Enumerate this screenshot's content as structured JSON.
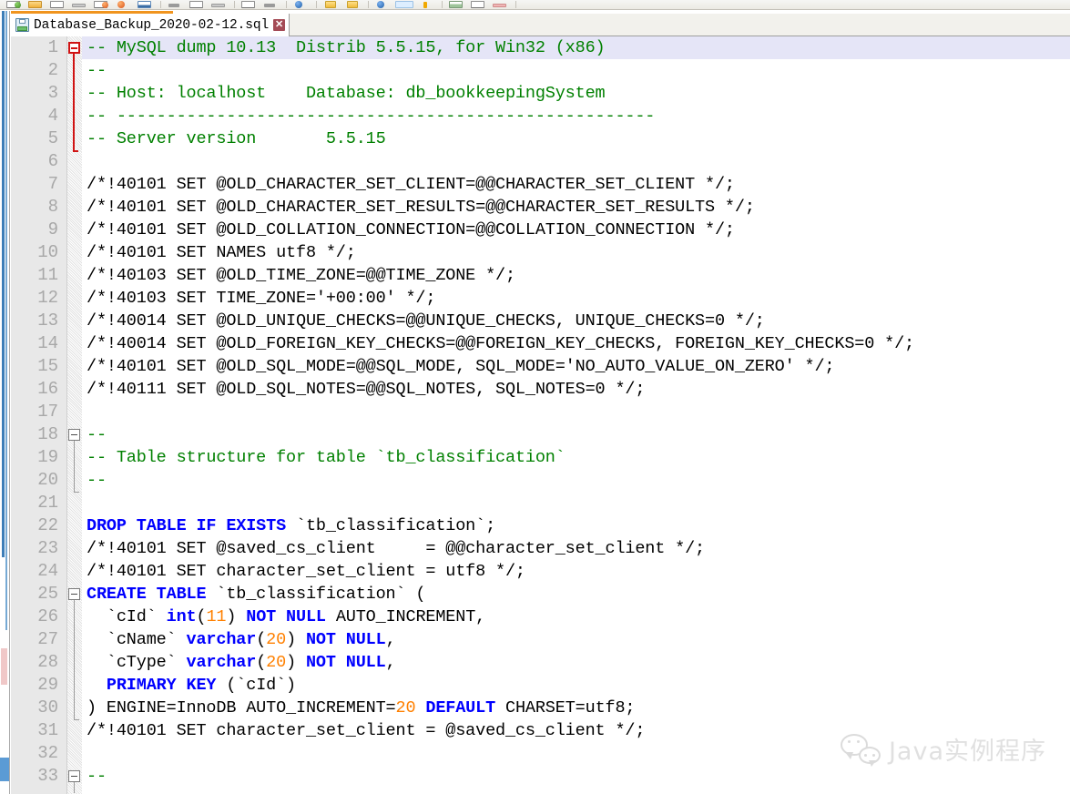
{
  "toolbar": {
    "items": [
      {
        "name": "new-file-icon",
        "style": "g-green"
      },
      {
        "name": "open-folder-icon",
        "style": "g-folder"
      },
      {
        "name": "save-icon",
        "style": "g-plain"
      },
      {
        "name": "save-all-icon",
        "style": "g-gray"
      },
      {
        "name": "close-file-icon",
        "style": "g-orange"
      },
      {
        "name": "close-all-icon",
        "style": "g-orangesolid"
      },
      {
        "name": "print-icon",
        "style": "g-bluebox"
      },
      {
        "sep": true
      },
      {
        "name": "cut-icon",
        "style": "g-darkgray"
      },
      {
        "name": "copy-icon",
        "style": "g-plain"
      },
      {
        "name": "paste-icon",
        "style": "g-gray"
      },
      {
        "sep": true
      },
      {
        "name": "undo-icon",
        "style": "g-plain"
      },
      {
        "name": "redo-icon",
        "style": "g-darkgray"
      },
      {
        "sep": true
      },
      {
        "name": "find-icon",
        "style": "g-blue"
      },
      {
        "sep": true
      },
      {
        "name": "zoom-in-icon",
        "style": "g-yellow"
      },
      {
        "name": "zoom-out-icon",
        "style": "g-yellow"
      },
      {
        "sep": true
      },
      {
        "name": "show-symbol-icon",
        "style": "g-blue"
      },
      {
        "name": "word-wrap-icon",
        "style": "g-lightblue"
      },
      {
        "name": "bookmark-icon",
        "style": "g-amber"
      },
      {
        "sep": true
      },
      {
        "name": "macro-record-icon",
        "style": "g-greenbar"
      },
      {
        "name": "macro-stop-icon",
        "style": "g-plain"
      },
      {
        "name": "macro-play-icon",
        "style": "g-pink"
      },
      {
        "sep": true
      }
    ]
  },
  "tab": {
    "title": "Database_Backup_2020-02-12.sql",
    "close_label": "✕",
    "icon_name": "floppy-disk-icon"
  },
  "editor": {
    "current_line": 1,
    "colors": {
      "comment": "#008000",
      "keyword": "#0000ff",
      "number": "#ff8000",
      "text": "#000000",
      "current_line_bg": "#e5e5f7",
      "gutter_bg": "#e8e8e8",
      "line_number": "#a8a8a8",
      "fold_active": "#d01414",
      "fold_inactive": "#7b7b7b"
    },
    "folds": [
      {
        "start": 1,
        "end": 5,
        "active": true
      },
      {
        "start": 18,
        "end": 20,
        "active": false
      },
      {
        "start": 25,
        "end": 30,
        "active": false
      },
      {
        "start": 33,
        "end": 33,
        "active": false
      }
    ],
    "lines": [
      {
        "n": 1,
        "tokens": [
          {
            "t": "-- MySQL dump 10.13  Distrib 5.5.15, for Win32 (x86)",
            "c": "c-comment"
          }
        ]
      },
      {
        "n": 2,
        "tokens": [
          {
            "t": "--",
            "c": "c-comment"
          }
        ]
      },
      {
        "n": 3,
        "tokens": [
          {
            "t": "-- Host: localhost    Database: db_bookkeepingSystem",
            "c": "c-comment"
          }
        ]
      },
      {
        "n": 4,
        "tokens": [
          {
            "t": "-- ------------------------------------------------------",
            "c": "c-comment"
          }
        ]
      },
      {
        "n": 5,
        "tokens": [
          {
            "t": "-- Server version\t5.5.15",
            "c": "c-comment"
          }
        ]
      },
      {
        "n": 6,
        "tokens": []
      },
      {
        "n": 7,
        "tokens": [
          {
            "t": "/*!40101 SET @OLD_CHARACTER_SET_CLIENT=@@CHARACTER_SET_CLIENT */;",
            "c": "c-plain"
          }
        ]
      },
      {
        "n": 8,
        "tokens": [
          {
            "t": "/*!40101 SET @OLD_CHARACTER_SET_RESULTS=@@CHARACTER_SET_RESULTS */;",
            "c": "c-plain"
          }
        ]
      },
      {
        "n": 9,
        "tokens": [
          {
            "t": "/*!40101 SET @OLD_COLLATION_CONNECTION=@@COLLATION_CONNECTION */;",
            "c": "c-plain"
          }
        ]
      },
      {
        "n": 10,
        "tokens": [
          {
            "t": "/*!40101 SET NAMES utf8 */;",
            "c": "c-plain"
          }
        ]
      },
      {
        "n": 11,
        "tokens": [
          {
            "t": "/*!40103 SET @OLD_TIME_ZONE=@@TIME_ZONE */;",
            "c": "c-plain"
          }
        ]
      },
      {
        "n": 12,
        "tokens": [
          {
            "t": "/*!40103 SET TIME_ZONE='+00:00' */;",
            "c": "c-plain"
          }
        ]
      },
      {
        "n": 13,
        "tokens": [
          {
            "t": "/*!40014 SET @OLD_UNIQUE_CHECKS=@@UNIQUE_CHECKS, UNIQUE_CHECKS=0 */;",
            "c": "c-plain"
          }
        ]
      },
      {
        "n": 14,
        "tokens": [
          {
            "t": "/*!40014 SET @OLD_FOREIGN_KEY_CHECKS=@@FOREIGN_KEY_CHECKS, FOREIGN_KEY_CHECKS=0 */;",
            "c": "c-plain"
          }
        ]
      },
      {
        "n": 15,
        "tokens": [
          {
            "t": "/*!40101 SET @OLD_SQL_MODE=@@SQL_MODE, SQL_MODE='NO_AUTO_VALUE_ON_ZERO' */;",
            "c": "c-plain"
          }
        ]
      },
      {
        "n": 16,
        "tokens": [
          {
            "t": "/*!40111 SET @OLD_SQL_NOTES=@@SQL_NOTES, SQL_NOTES=0 */;",
            "c": "c-plain"
          }
        ]
      },
      {
        "n": 17,
        "tokens": []
      },
      {
        "n": 18,
        "tokens": [
          {
            "t": "--",
            "c": "c-comment"
          }
        ]
      },
      {
        "n": 19,
        "tokens": [
          {
            "t": "-- Table structure for table `tb_classification`",
            "c": "c-comment"
          }
        ]
      },
      {
        "n": 20,
        "tokens": [
          {
            "t": "--",
            "c": "c-comment"
          }
        ]
      },
      {
        "n": 21,
        "tokens": []
      },
      {
        "n": 22,
        "tokens": [
          {
            "t": "DROP TABLE IF EXISTS",
            "c": "c-kw"
          },
          {
            "t": " `tb_classification`;",
            "c": "c-plain"
          }
        ]
      },
      {
        "n": 23,
        "tokens": [
          {
            "t": "/*!40101 SET @saved_cs_client     = @@character_set_client */;",
            "c": "c-plain"
          }
        ]
      },
      {
        "n": 24,
        "tokens": [
          {
            "t": "/*!40101 SET character_set_client = utf8 */;",
            "c": "c-plain"
          }
        ]
      },
      {
        "n": 25,
        "tokens": [
          {
            "t": "CREATE TABLE",
            "c": "c-kw"
          },
          {
            "t": " `tb_classification` (",
            "c": "c-plain"
          }
        ]
      },
      {
        "n": 26,
        "tokens": [
          {
            "t": "  `cId` ",
            "c": "c-plain"
          },
          {
            "t": "int",
            "c": "c-kw"
          },
          {
            "t": "(",
            "c": "c-plain"
          },
          {
            "t": "11",
            "c": "c-num"
          },
          {
            "t": ") ",
            "c": "c-plain"
          },
          {
            "t": "NOT NULL",
            "c": "c-kw"
          },
          {
            "t": " AUTO_INCREMENT,",
            "c": "c-plain"
          }
        ]
      },
      {
        "n": 27,
        "tokens": [
          {
            "t": "  `cName` ",
            "c": "c-plain"
          },
          {
            "t": "varchar",
            "c": "c-kw"
          },
          {
            "t": "(",
            "c": "c-plain"
          },
          {
            "t": "20",
            "c": "c-num"
          },
          {
            "t": ") ",
            "c": "c-plain"
          },
          {
            "t": "NOT NULL",
            "c": "c-kw"
          },
          {
            "t": ",",
            "c": "c-plain"
          }
        ]
      },
      {
        "n": 28,
        "tokens": [
          {
            "t": "  `cType` ",
            "c": "c-plain"
          },
          {
            "t": "varchar",
            "c": "c-kw"
          },
          {
            "t": "(",
            "c": "c-plain"
          },
          {
            "t": "20",
            "c": "c-num"
          },
          {
            "t": ") ",
            "c": "c-plain"
          },
          {
            "t": "NOT NULL",
            "c": "c-kw"
          },
          {
            "t": ",",
            "c": "c-plain"
          }
        ]
      },
      {
        "n": 29,
        "tokens": [
          {
            "t": "  ",
            "c": "c-plain"
          },
          {
            "t": "PRIMARY KEY",
            "c": "c-kw"
          },
          {
            "t": " (`cId`)",
            "c": "c-plain"
          }
        ]
      },
      {
        "n": 30,
        "tokens": [
          {
            "t": ") ENGINE=InnoDB AUTO_INCREMENT=",
            "c": "c-plain"
          },
          {
            "t": "20",
            "c": "c-num"
          },
          {
            "t": " ",
            "c": "c-plain"
          },
          {
            "t": "DEFAULT",
            "c": "c-kw"
          },
          {
            "t": " CHARSET=utf8;",
            "c": "c-plain"
          }
        ]
      },
      {
        "n": 31,
        "tokens": [
          {
            "t": "/*!40101 SET character_set_client = @saved_cs_client */;",
            "c": "c-plain"
          }
        ]
      },
      {
        "n": 32,
        "tokens": []
      },
      {
        "n": 33,
        "tokens": [
          {
            "t": "--",
            "c": "c-comment"
          }
        ]
      }
    ]
  },
  "watermark": {
    "text": "Java实例程序",
    "icon_name": "wechat-icon"
  }
}
